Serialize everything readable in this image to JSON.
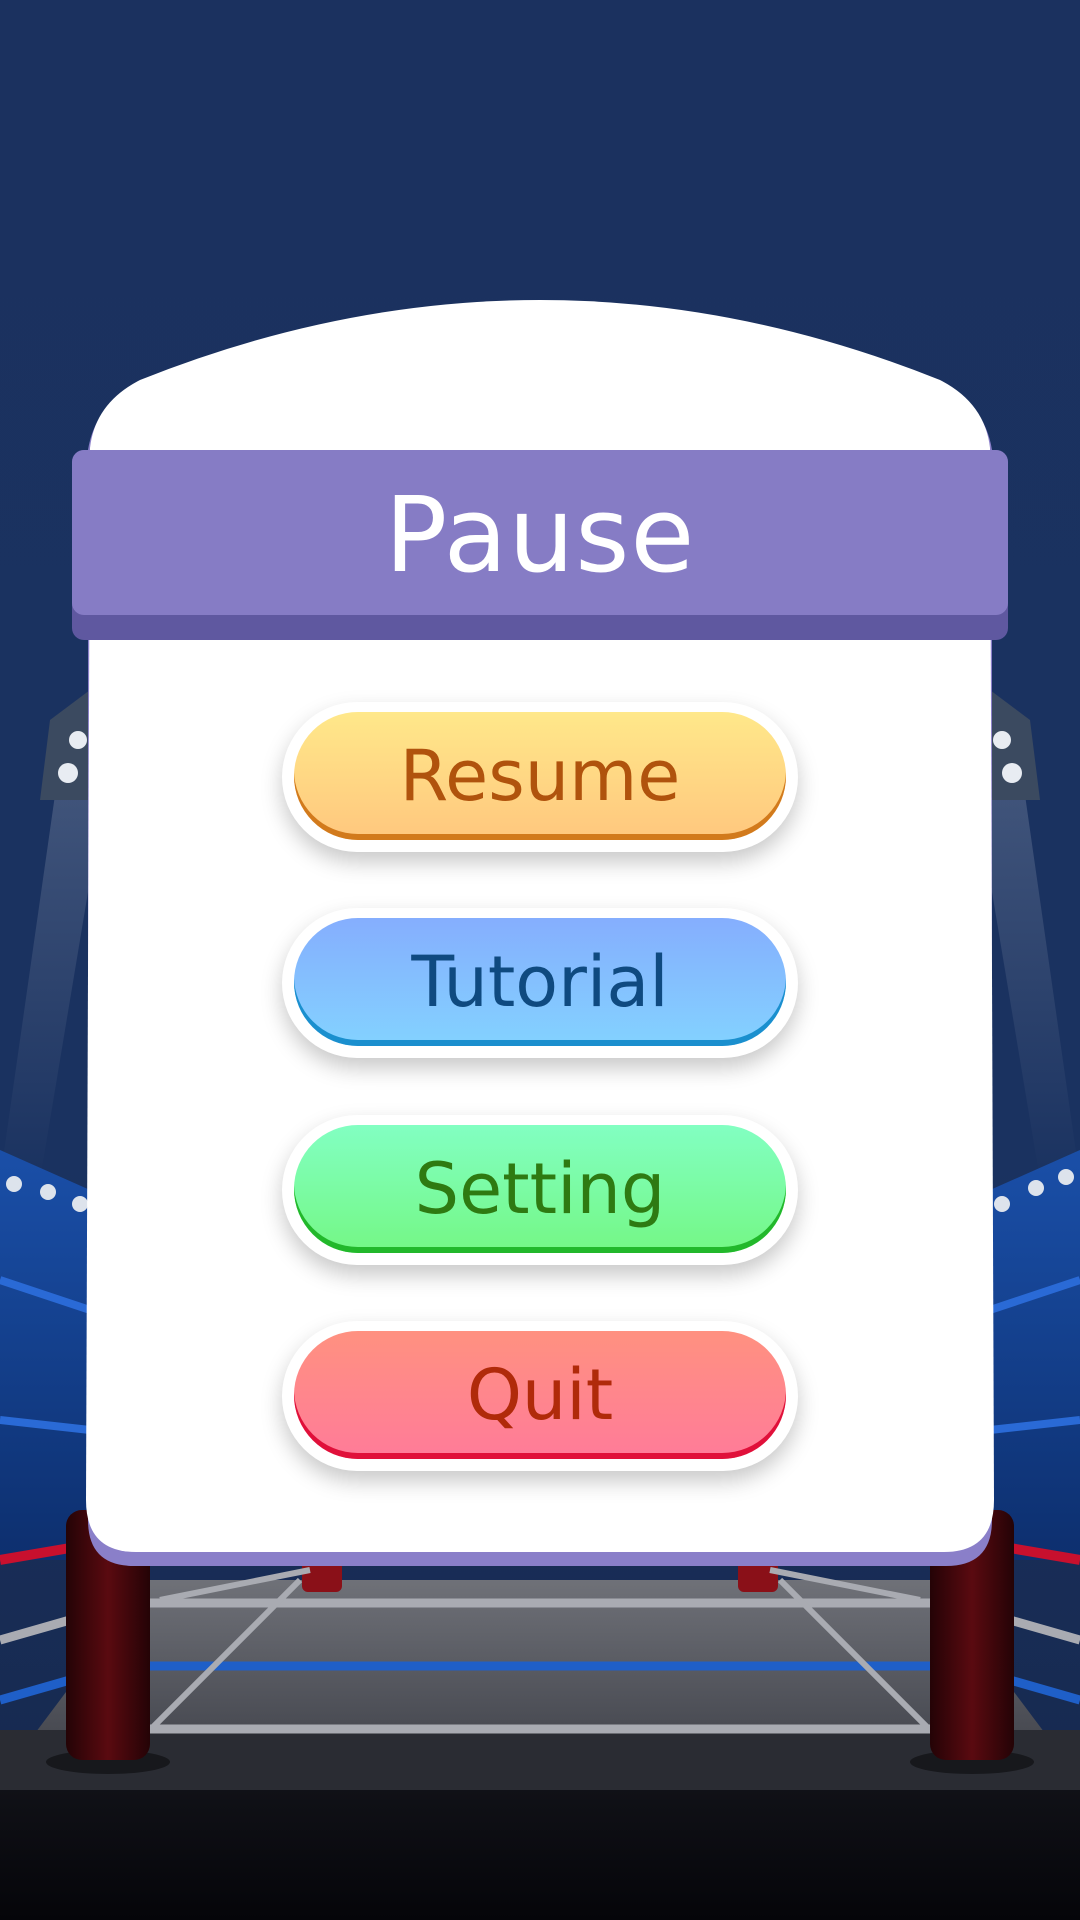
{
  "dialog": {
    "title": "Pause"
  },
  "buttons": {
    "resume": {
      "label": "Resume"
    },
    "tutorial": {
      "label": "Tutorial"
    },
    "setting": {
      "label": "Setting"
    },
    "quit": {
      "label": "Quit"
    }
  },
  "colors": {
    "background": "#1b325f",
    "header": "#867cc5",
    "header_shadow": "#5f58a0",
    "panel": "#ffffff",
    "panel_bottom_edge": "#8a7fc9"
  }
}
